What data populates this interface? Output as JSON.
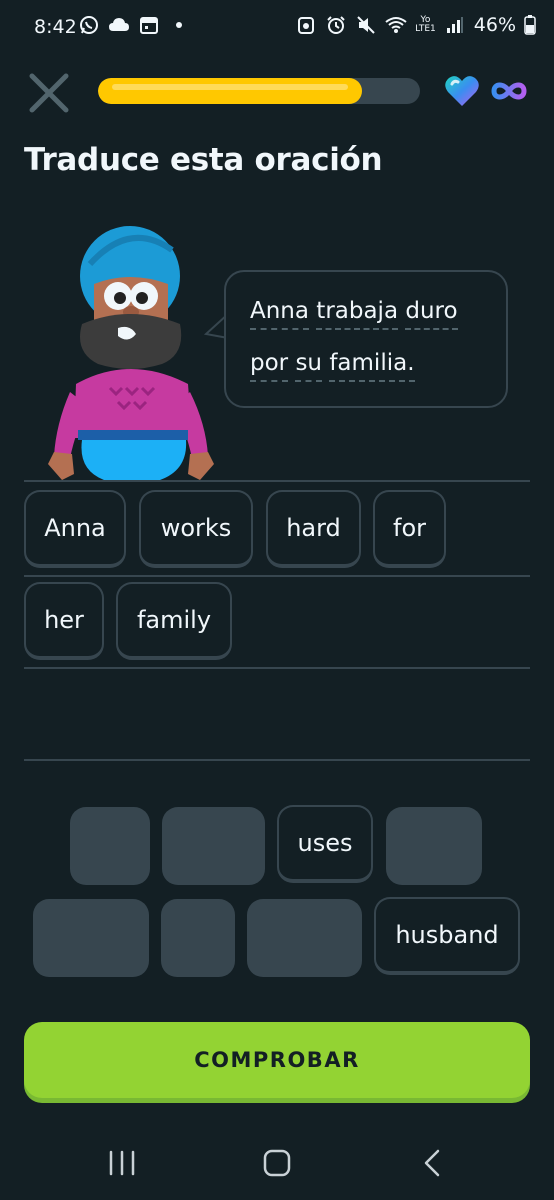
{
  "status_bar": {
    "time": "8:42",
    "battery": "46%",
    "network": "LTE1",
    "carrier_tag": "Yo"
  },
  "header": {
    "progress_fraction": 0.82,
    "progress_color": "#ffc800",
    "hearts": "infinite"
  },
  "page": {
    "title": "Traduce esta oración"
  },
  "prompt": {
    "line1_words": [
      "Anna",
      "trabaja",
      "duro"
    ],
    "line2_words": [
      "por",
      "su",
      "familia."
    ]
  },
  "answer_tiles": [
    "Anna",
    "works",
    "hard",
    "for",
    "her",
    "family"
  ],
  "word_bank": {
    "row1": [
      "",
      "",
      "uses",
      ""
    ],
    "row2": [
      "",
      "",
      "",
      "husband"
    ]
  },
  "check_button": {
    "label": "COMPROBAR",
    "color": "#93d333"
  },
  "colors": {
    "background": "#131f24",
    "border": "#37464f",
    "text": "#f1f7fb"
  }
}
